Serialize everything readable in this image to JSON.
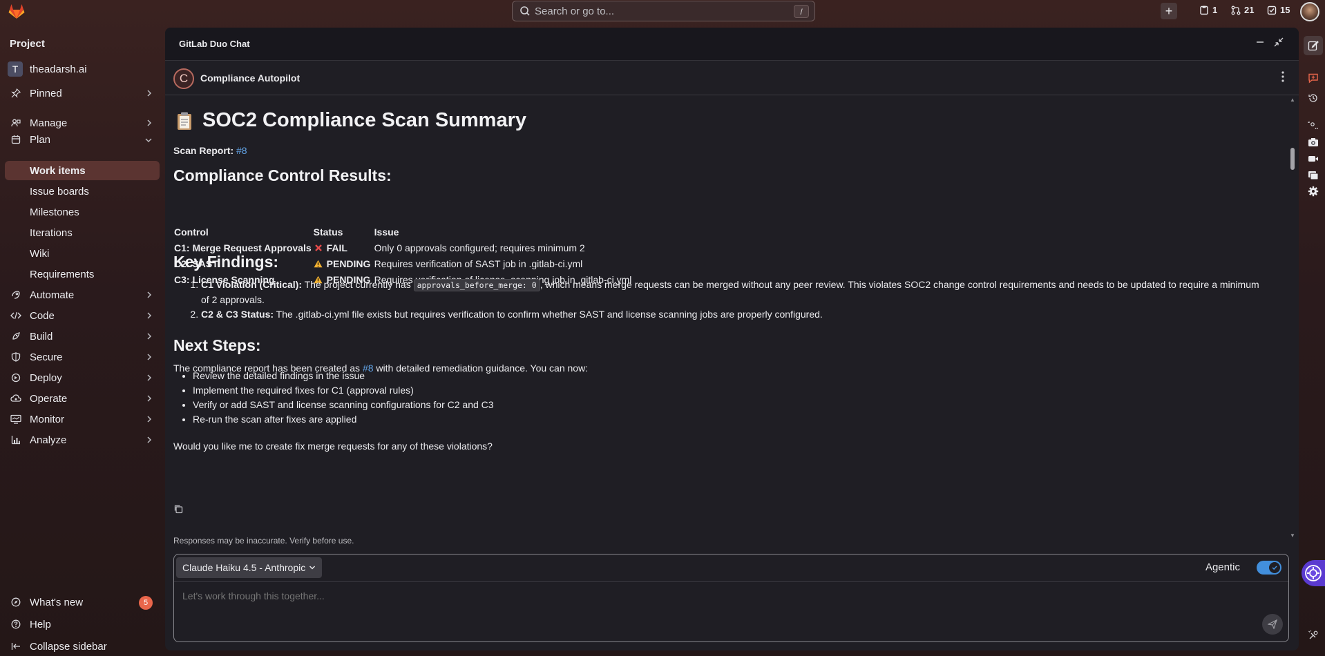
{
  "topbar": {
    "search_placeholder": "Search or go to...",
    "search_shortcut": "/",
    "counters": [
      {
        "icon": "issues-icon",
        "value": "1"
      },
      {
        "icon": "merge-request-icon",
        "value": "21"
      },
      {
        "icon": "todo-icon",
        "value": "15"
      }
    ]
  },
  "sidebar": {
    "section_title": "Project",
    "project": {
      "initial": "T",
      "name": "theadarsh.ai"
    },
    "pinned": "Pinned",
    "items": [
      {
        "label": "Manage",
        "icon": "users-icon"
      },
      {
        "label": "Plan",
        "icon": "calendar-icon"
      },
      {
        "label": "Automate",
        "icon": "rocket-icon"
      },
      {
        "label": "Code",
        "icon": "code-icon"
      },
      {
        "label": "Build",
        "icon": "rocket-launch-icon"
      },
      {
        "label": "Secure",
        "icon": "shield-icon"
      },
      {
        "label": "Deploy",
        "icon": "deployments-icon"
      },
      {
        "label": "Operate",
        "icon": "cloud-gear-icon"
      },
      {
        "label": "Monitor",
        "icon": "monitor-icon"
      },
      {
        "label": "Analyze",
        "icon": "chart-icon"
      }
    ],
    "plan_sub": [
      "Work items",
      "Issue boards",
      "Milestones",
      "Iterations",
      "Wiki",
      "Requirements"
    ],
    "whats_new": "What's new",
    "whats_new_count": "5",
    "help": "Help",
    "collapse": "Collapse sidebar"
  },
  "chat": {
    "panel_title": "GitLab Duo Chat",
    "agent_initial": "C",
    "agent_name": "Compliance Autopilot",
    "heading": "SOC2 Compliance Scan Summary",
    "scan_report_label": "Scan Report:",
    "scan_report_link": "#8",
    "results_heading": "Compliance Control Results:",
    "table": {
      "headers": [
        "Control",
        "Status",
        "Issue"
      ],
      "rows": [
        {
          "control": "C1: Merge Request Approvals",
          "status_icon": "fail-x-icon",
          "status": "FAIL",
          "issue": "Only 0 approvals configured; requires minimum 2"
        },
        {
          "control": "C2: SAST",
          "status_icon": "warning-icon",
          "status": "PENDING",
          "issue": "Requires verification of SAST job in .gitlab-ci.yml"
        },
        {
          "control": "C3: License Scanning",
          "status_icon": "warning-icon",
          "status": "PENDING",
          "issue": "Requires verification of license_scanning job in .gitlab-ci.yml"
        }
      ]
    },
    "findings_heading": "Key Findings:",
    "findings": [
      {
        "title": "C1 Violation (Critical):",
        "pre": "The project currently has",
        "code": "approvals_before_merge: 0",
        "post": ", which means merge requests can be merged without any peer review. This violates SOC2 change control requirements and needs to be updated to require a minimum of 2 approvals."
      },
      {
        "title": "C2 & C3 Status:",
        "text": "The .gitlab-ci.yml file exists but requires verification to confirm whether SAST and license scanning jobs are properly configured."
      }
    ],
    "next_heading": "Next Steps:",
    "next_intro_pre": "The compliance report has been created as",
    "next_intro_link": "#8",
    "next_intro_post": "with detailed remediation guidance. You can now:",
    "next_steps": [
      "Review the detailed findings in the issue",
      "Implement the required fixes for C1 (approval rules)",
      "Verify or add SAST and license scanning configurations for C2 and C3",
      "Re-run the scan after fixes are applied"
    ],
    "closing_question": "Would you like me to create fix merge requests for any of these violations?",
    "disclaimer": "Responses may be inaccurate. Verify before use.",
    "model_selector": "Claude Haiku 4.5 - Anthropic",
    "agentic_label": "Agentic",
    "agentic_on": true,
    "input_placeholder": "Let's work through this together..."
  },
  "colors": {
    "link": "#63a6e9",
    "active_nav": "#5b3431",
    "badge": "#e9664b",
    "toggle": "#428fdc",
    "duo_button": "#5a3ad0"
  }
}
